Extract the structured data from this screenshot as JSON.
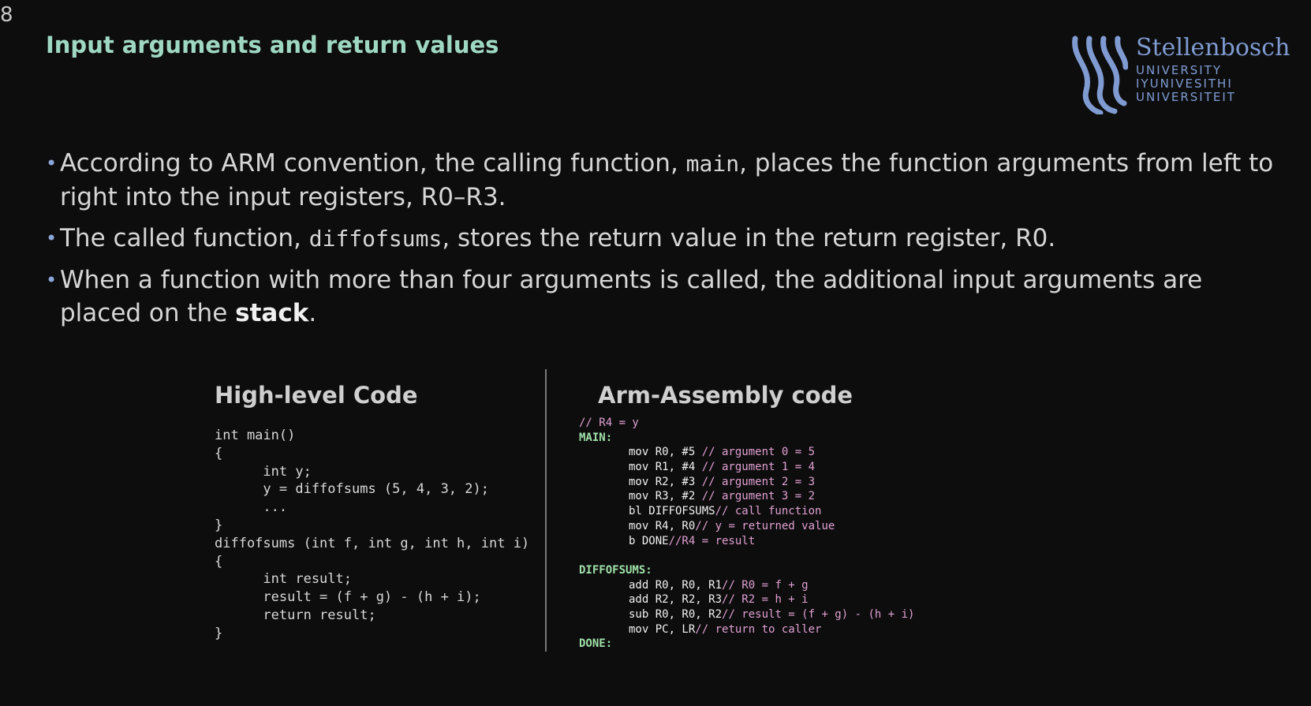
{
  "slide": {
    "number": "8",
    "title": "Input arguments and return values"
  },
  "logo": {
    "name": "Stellenbosch",
    "lines": [
      "UNIVERSITY",
      "IYUNIVESITHI",
      "UNIVERSITEIT"
    ],
    "color": "#7f9bd1"
  },
  "bullets": [
    {
      "pre": "According to ARM convention, the calling function, ",
      "code": "main",
      "post": ", places the function arguments from left to right into the input registers, R0–R3."
    },
    {
      "pre": "The called function, ",
      "code": "diffofsums",
      "post": ", stores the return value in the return register, R0."
    },
    {
      "pre": "When a function with more than four arguments is called, the additional input arguments are placed on the ",
      "bold": "stack",
      "post": "."
    }
  ],
  "high_level": {
    "heading": "High-level Code",
    "lines": [
      "int main()",
      "{",
      "      int y;",
      "      y = diffofsums (5, 4, 3, 2);",
      "      ...",
      "}",
      "diffofsums (int f, int g, int h, int i)",
      "{",
      "      int result;",
      "      result = (f + g) - (h + i);",
      "      return result;",
      "}"
    ]
  },
  "assembly": {
    "heading": "Arm-Assembly code",
    "lines": [
      {
        "type": "comment",
        "comment": "// R4 = y"
      },
      {
        "type": "label",
        "label": "MAIN:"
      },
      {
        "type": "instr",
        "instr": "mov R0, #5 ",
        "comment": "// argument 0 = 5"
      },
      {
        "type": "instr",
        "instr": "mov R1, #4 ",
        "comment": "// argument 1 = 4"
      },
      {
        "type": "instr",
        "instr": "mov R2, #3 ",
        "comment": "// argument 2 = 3"
      },
      {
        "type": "instr",
        "instr": "mov R3, #2 ",
        "comment": "// argument 3 = 2"
      },
      {
        "type": "instr",
        "instr": "bl DIFFOFSUMS",
        "comment": "// call function"
      },
      {
        "type": "instr",
        "instr": "mov R4, R0",
        "comment": "// y = returned value"
      },
      {
        "type": "instr",
        "instr": "b DONE",
        "comment": "//R4 = result"
      },
      {
        "type": "blank"
      },
      {
        "type": "label",
        "label": "DIFFOFSUMS:"
      },
      {
        "type": "instr",
        "instr": "add R0, R0, R1",
        "comment": "// R0 = f + g"
      },
      {
        "type": "instr",
        "instr": "add R2, R2, R3",
        "comment": "// R2 = h + i"
      },
      {
        "type": "instr",
        "instr": "sub R0, R0, R2",
        "comment": "// result = (f + g) - (h + i)"
      },
      {
        "type": "instr",
        "instr": "mov PC, LR",
        "comment": "// return to caller"
      },
      {
        "type": "label",
        "label": "DONE:"
      }
    ]
  }
}
